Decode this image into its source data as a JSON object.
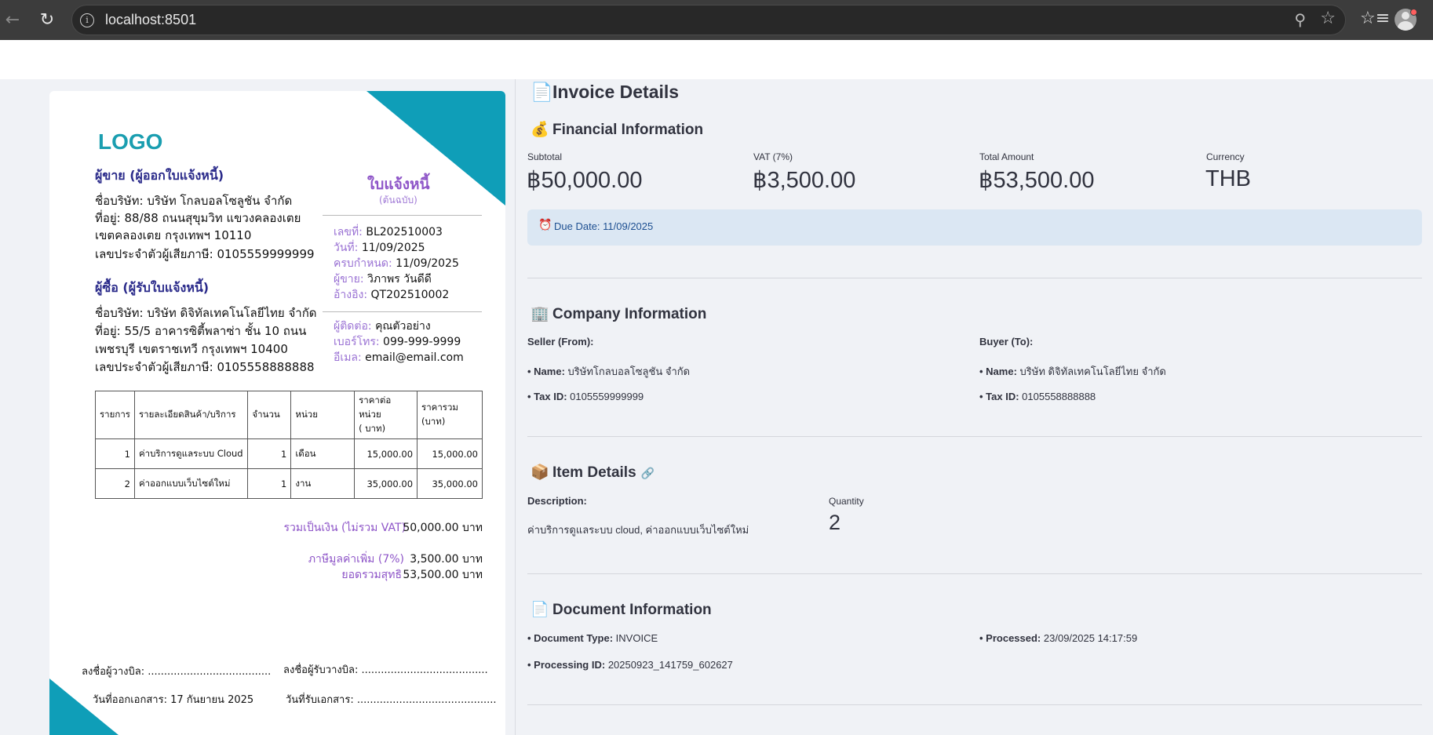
{
  "browser": {
    "url": "localhost:8501",
    "back_icon": "arrow-left-icon",
    "reload_icon": "reload-icon"
  },
  "invoice": {
    "logo": "LOGO",
    "seller_heading": "ผู้ขาย (ผู้ออกใบแจ้งหนี้)",
    "seller_lines": [
      "ชื่อบริษัท: บริษัท โกลบอลโซลูชัน จำกัด",
      "ที่อยู่: 88/88 ถนนสุขุมวิท แขวงคลองเตย",
      "เขตคลองเตย กรุงเทพฯ 10110",
      "เลขประจำตัวผู้เสียภาษี: 0105559999999"
    ],
    "buyer_heading": "ผู้ซื้อ (ผู้รับใบแจ้งหนี้)",
    "buyer_lines": [
      "ชื่อบริษัท: บริษัท ดิจิทัลเทคโนโลยีไทย จำกัด",
      "ที่อยู่: 55/5 อาคารซิตี้พลาซ่า ชั้น 10 ถนน",
      "เพชรบุรี เขตราชเทวี กรุงเทพฯ 10400",
      "เลขประจำตัวผู้เสียภาษี: 0105558888888"
    ],
    "doc_title": "ใบแจ้งหนี้",
    "doc_subtitle": "(ต้นฉบับ)",
    "meta": [
      {
        "label": "เลขที่:",
        "value": "BL202510003"
      },
      {
        "label": "วันที่:",
        "value": "11/09/2025"
      },
      {
        "label": "ครบกำหนด:",
        "value": "11/09/2025"
      },
      {
        "label": "ผู้ขาย:",
        "value": "วิภาพร วันดีดี"
      },
      {
        "label": "อ้างอิง:",
        "value": "QT202510002"
      }
    ],
    "contact": [
      {
        "label": "ผู้ติดต่อ:",
        "value": "คุณตัวอย่าง"
      },
      {
        "label": "เบอร์โทร:",
        "value": "099-999-9999"
      },
      {
        "label": "อีเมล:",
        "value": "email@email.com"
      }
    ],
    "table": {
      "headers": [
        "รายการ",
        "รายละเอียดสินค้า/บริการ",
        "จำนวน",
        "หน่วย",
        "ราคาต่อหน่วย\n( บาท)",
        "ราคารวม\n(บาท)"
      ],
      "rows": [
        [
          "1",
          "ค่าบริการดูแลระบบ Cloud",
          "1",
          "เดือน",
          "15,000.00",
          "15,000.00"
        ],
        [
          "2",
          "ค่าออกแบบเว็บไซต์ใหม่",
          "1",
          "งาน",
          "35,000.00",
          "35,000.00"
        ]
      ]
    },
    "totals": {
      "subtotal_label": "รวมเป็นเงิน (ไม่รวม VAT)",
      "subtotal_value": "50,000.00 บาท",
      "vat_label": "ภาษีมูลค่าเพิ่ม (7%)",
      "vat_value": "3,500.00 บาท",
      "net_label": "ยอดรวมสุทธิ",
      "net_value": "53,500.00 บาท"
    },
    "signatures": {
      "issuer_sign": "ลงชื่อผู้วางบิล: ......................................",
      "receiver_sign": "ลงชื่อผู้รับวางบิล: .......................................",
      "issue_date": "วันที่ออกเอกสาร: 17 กันยายน 2025",
      "receive_date": "วันที่รับเอกสาร: ..........................................."
    }
  },
  "details": {
    "title": "Invoice Details",
    "title_icon": "page-icon",
    "financial": {
      "heading": "Financial Information",
      "icon": "money-bag-icon",
      "metrics": [
        {
          "label": "Subtotal",
          "value": "฿50,000.00"
        },
        {
          "label": "VAT (7%)",
          "value": "฿3,500.00"
        },
        {
          "label": "Total Amount",
          "value": "฿53,500.00"
        },
        {
          "label": "Currency",
          "value": "THB"
        }
      ],
      "due_date": "Due Date: 11/09/2025"
    },
    "company": {
      "heading": "Company Information",
      "icon": "office-building-icon",
      "seller_title": "Seller (From):",
      "buyer_title": "Buyer (To):",
      "seller_name_label": "• Name:",
      "seller_name": "บริษัทโกลบอลโซลูชัน จำกัด",
      "seller_tax_label": "• Tax ID:",
      "seller_tax": "0105559999999",
      "buyer_name_label": "• Name:",
      "buyer_name": "บริษัท ดิจิทัลเทคโนโลยีไทย จำกัด",
      "buyer_tax_label": "• Tax ID:",
      "buyer_tax": "0105558888888"
    },
    "items": {
      "heading": "Item Details",
      "icon": "package-icon",
      "description_label": "Description:",
      "description": "ค่าบริการดูแลระบบ cloud, ค่าออกแบบเว็บไซต์ใหม่",
      "quantity_label": "Quantity",
      "quantity": "2"
    },
    "document": {
      "heading": "Document Information",
      "icon": "page-icon",
      "type_label": "• Document Type:",
      "type": "INVOICE",
      "processed_label": "• Processed:",
      "processed": "23/09/2025 14:17:59",
      "pid_label": "• Processing ID:",
      "pid": "20250923_141759_602627"
    }
  }
}
